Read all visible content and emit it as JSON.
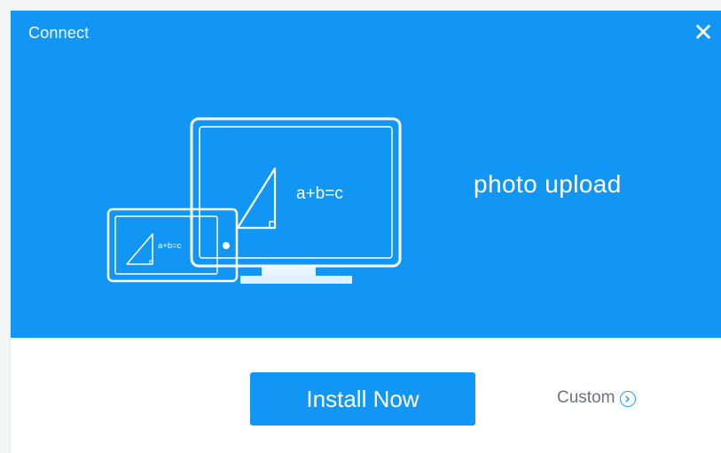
{
  "window": {
    "title": "Connect",
    "close_icon": "close-icon"
  },
  "banner": {
    "headline": "photo upload",
    "illustration": {
      "monitor_formula": "a+b=c",
      "tablet_formula": "a+b=c"
    }
  },
  "actions": {
    "install_label": "Install Now",
    "custom_label": "Custom",
    "custom_icon": "chevron-right-circle-icon"
  },
  "colors": {
    "accent": "#1296f5",
    "text_on_accent": "#ffffff",
    "secondary_text": "#6d737a"
  }
}
